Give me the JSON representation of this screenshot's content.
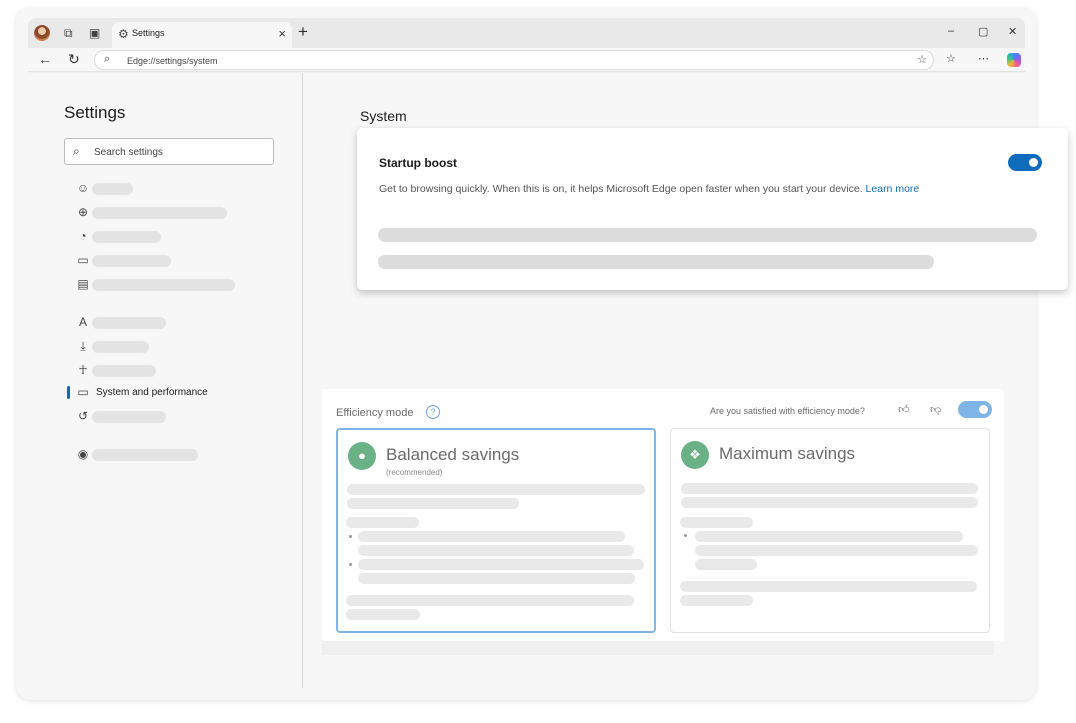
{
  "browser": {
    "tab_title": "Settings",
    "url": "Edge://settings/system",
    "window_controls": [
      "–",
      "▢",
      "✕"
    ]
  },
  "sidebar": {
    "title": "Settings",
    "search_placeholder": "Search settings",
    "selected_item": "System and performance"
  },
  "main": {
    "section_title": "System"
  },
  "startup_boost": {
    "title": "Startup boost",
    "description": "Get to browsing quickly. When this is on, it helps Microsoft Edge open faster when you start your device.",
    "learn_more": "Learn more",
    "enabled": true
  },
  "efficiency": {
    "title": "Efficiency mode",
    "feedback_question": "Are you satisfied with efficiency mode?",
    "enabled": true,
    "cards": [
      {
        "name": "Balanced savings",
        "subtitle": "(recommended)",
        "selected": true
      },
      {
        "name": "Maximum savings",
        "subtitle": "",
        "selected": false
      }
    ]
  },
  "colors": {
    "accent": "#0f6cbd",
    "card_highlight": "#7fb4e6",
    "badge_green": "#6ab186"
  }
}
